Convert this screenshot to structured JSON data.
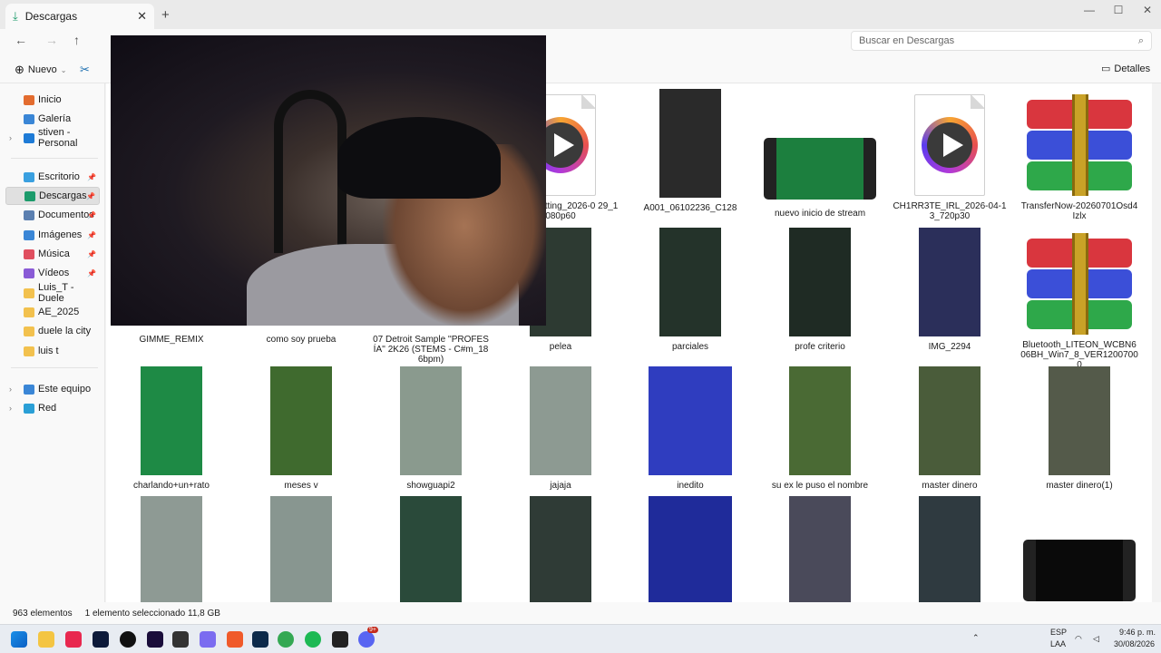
{
  "window": {
    "tab_title": "Descargas"
  },
  "search": {
    "placeholder": "Buscar en Descargas"
  },
  "commands": {
    "new_label": "Nuevo",
    "details_label": "Detalles"
  },
  "sidebar": {
    "items": [
      {
        "label": "Inicio",
        "color": "#e36c2f"
      },
      {
        "label": "Galería",
        "color": "#3a86d6"
      },
      {
        "label": "stiven - Personal",
        "color": "#1e7bd6"
      },
      {
        "label": "Escritorio",
        "color": "#3aa0e0"
      },
      {
        "label": "Descargas",
        "color": "#1c9b6b"
      },
      {
        "label": "Documentos",
        "color": "#5b7fb0"
      },
      {
        "label": "Imágenes",
        "color": "#3a86d6"
      },
      {
        "label": "Música",
        "color": "#e04f5f"
      },
      {
        "label": "Vídeos",
        "color": "#8a5bd6"
      },
      {
        "label": "Luis_T - Duele",
        "color": "#f2c14e"
      },
      {
        "label": "AE_2025",
        "color": "#f2c14e"
      },
      {
        "label": "duele la city",
        "color": "#f2c14e"
      },
      {
        "label": "luis t",
        "color": "#f2c14e"
      },
      {
        "label": "Este equipo",
        "color": "#3a86d6"
      },
      {
        "label": "Red",
        "color": "#2a9fd6"
      }
    ]
  },
  "files": [
    {
      "name": "st%20Chatting_2026-0 29_1080p60",
      "kind": "media"
    },
    {
      "name": "A001_06102236_C128",
      "kind": "video",
      "color": "#2a2a2a"
    },
    {
      "name": "nuevo inicio de stream",
      "kind": "film"
    },
    {
      "name": "CH1RR3TE_IRL_2026-04-13_720p30",
      "kind": "media"
    },
    {
      "name": "TransferNow-20260701Osd4Izlx",
      "kind": "rar"
    },
    {
      "name": "GIMME_REMIX",
      "kind": "hidden"
    },
    {
      "name": "como soy prueba",
      "kind": "hidden"
    },
    {
      "name": "07 Detroit Sample ''PROFESÍA'' 2K26 (STEMS - C#m_186bpm)",
      "kind": "hidden"
    },
    {
      "name": "pelea",
      "kind": "video",
      "color": "#2d3a32"
    },
    {
      "name": "parciales",
      "kind": "video",
      "color": "#24332a"
    },
    {
      "name": "profe criterio",
      "kind": "video",
      "color": "#1f2b24"
    },
    {
      "name": "IMG_2294",
      "kind": "video",
      "color": "#2b2f5a"
    },
    {
      "name": "Bluetooth_LITEON_WCBN606BH_Win7_8_VER12007000",
      "kind": "rar"
    },
    {
      "name": "charlando+un+rato",
      "kind": "video",
      "color": "#1e8a45"
    },
    {
      "name": "meses v",
      "kind": "video",
      "color": "#3f6a2e"
    },
    {
      "name": "showguapi2",
      "kind": "video",
      "color": "#8a9a8e"
    },
    {
      "name": "jajaja",
      "kind": "video",
      "color": "#8d9a92"
    },
    {
      "name": "inedito",
      "kind": "videow",
      "color": "#2f3dbf"
    },
    {
      "name": "su ex le puso el nombre",
      "kind": "video",
      "color": "#4a6a34"
    },
    {
      "name": "master dinero",
      "kind": "video",
      "color": "#4a5c3a"
    },
    {
      "name": "master dinero(1)",
      "kind": "video",
      "color": "#545a4a"
    },
    {
      "name": "",
      "kind": "video",
      "color": "#8e9a94"
    },
    {
      "name": "",
      "kind": "video",
      "color": "#889690"
    },
    {
      "name": "",
      "kind": "video",
      "color": "#2a4a3a"
    },
    {
      "name": "",
      "kind": "video",
      "color": "#2f3b36"
    },
    {
      "name": "",
      "kind": "videow",
      "color": "#1f2b9a"
    },
    {
      "name": "",
      "kind": "video",
      "color": "#4a4a5a"
    },
    {
      "name": "",
      "kind": "video",
      "color": "#2f3a40"
    },
    {
      "name": "",
      "kind": "film"
    }
  ],
  "status": {
    "count": "963 elementos",
    "selection": "1 elemento seleccionado  11,8 GB"
  },
  "taskbar": {
    "lang": "ESP",
    "layout": "LAA",
    "time": "9:46 p. m.",
    "date": "30/08/2026",
    "badge": "9+"
  }
}
